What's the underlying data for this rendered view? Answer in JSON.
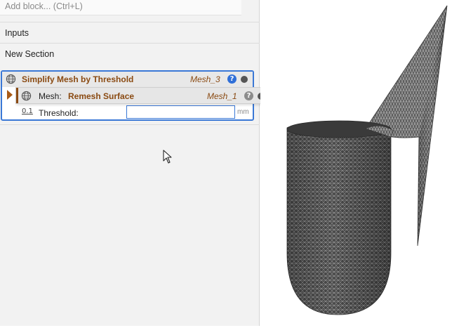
{
  "left_panel": {
    "add_block_placeholder": "Add block... (Ctrl+L)",
    "sections": {
      "inputs": "Inputs",
      "new_section": "New Section"
    }
  },
  "block": {
    "title": "Simplify Mesh by Threshold",
    "output_ref": "Mesh_3",
    "help": "?",
    "mesh_input": {
      "label": "Mesh:",
      "source": "Remesh Surface",
      "ref": "Mesh_1",
      "help": "?"
    },
    "threshold": {
      "label": "Threshold:",
      "value": "",
      "unit": "mm",
      "type_icon": "0.1"
    }
  },
  "colors": {
    "accent": "#3a78d6",
    "block_text": "#8a4a12",
    "panel_bg": "#f2f2f2",
    "mesh_fill": "#5a5a5a"
  },
  "icons": [
    "globe-icon",
    "help-icon",
    "status-dot-icon",
    "expand-arrow-icon",
    "number-icon",
    "mouse-cursor-icon"
  ],
  "viewport": {
    "description": "mesh-render"
  }
}
